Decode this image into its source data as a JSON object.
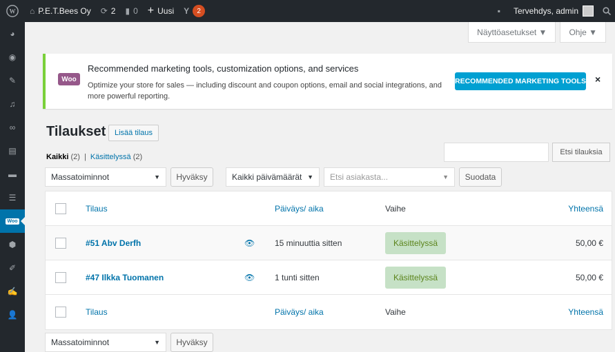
{
  "adminbar": {
    "site_name": "P.E.T.Bees Oy",
    "updates_count": "2",
    "comments_count": "0",
    "new_label": "Uusi",
    "yoast_badge": "2",
    "greeting": "Tervehdys, admin"
  },
  "screen_meta": {
    "screen_options": "Näyttöasetukset ▼",
    "help": "Ohje ▼"
  },
  "notice": {
    "logo_text": "Woo",
    "title": "Recommended marketing tools, customization options, and services",
    "text": "Optimize your store for sales — including discount and coupon options, email and social integrations, and more powerful reporting.",
    "button": "RECOMMENDED MARKETING TOOLS",
    "close": "×"
  },
  "page": {
    "title": "Tilaukset",
    "add_new": "Lisää tilaus"
  },
  "filters": {
    "all_label": "Kaikki",
    "all_count": "(2)",
    "separator": "|",
    "processing_label": "Käsittelyssä",
    "processing_count": "(2)"
  },
  "search": {
    "value": "",
    "button": "Etsi tilauksia"
  },
  "tablenav": {
    "bulk_actions": "Massatoiminnot",
    "apply": "Hyväksy",
    "all_dates": "Kaikki päivämäärät",
    "customer_placeholder": "Etsi asiakasta...",
    "filter": "Suodata"
  },
  "table": {
    "columns": {
      "order": "Tilaus",
      "date": "Päiväys/ aika",
      "status": "Vaihe",
      "total": "Yhteensä"
    },
    "rows": [
      {
        "order": "#51 Abv Derfh",
        "date": "15 minuuttia sitten",
        "status": "Käsittelyssä",
        "total": "50,00 €"
      },
      {
        "order": "#47 Ilkka Tuomanen",
        "date": "1 tunti sitten",
        "status": "Käsittelyssä",
        "total": "50,00 €"
      }
    ]
  },
  "colors": {
    "adminbar_bg": "#23282d",
    "accent": "#0073aa",
    "status_bg": "#c6e1c6",
    "status_text": "#5b841b",
    "notice_border": "#7ad03a",
    "woo_purple": "#96588a"
  }
}
